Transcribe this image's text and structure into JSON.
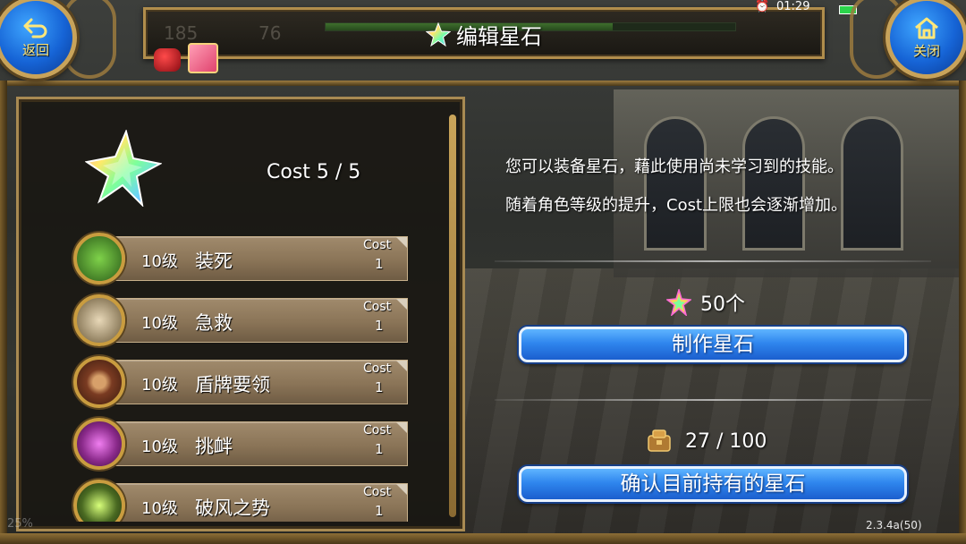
{
  "status_bar": {
    "time": "01:29"
  },
  "hud": {
    "stat_a": "185",
    "stat_b": "76"
  },
  "header": {
    "title": "编辑星石"
  },
  "nav": {
    "back_label": "返回",
    "close_label": "关闭"
  },
  "panel": {
    "cost_text": "Cost 5 / 5",
    "skills": [
      {
        "level": "10级",
        "name": "装死",
        "cost_label": "Cost",
        "cost": "1",
        "icon": "feign-death-icon",
        "color": "#3c7a2a"
      },
      {
        "level": "10级",
        "name": "急救",
        "cost_label": "Cost",
        "cost": "1",
        "icon": "first-aid-icon",
        "color": "#6b5a3a"
      },
      {
        "level": "10级",
        "name": "盾牌要领",
        "cost_label": "Cost",
        "cost": "1",
        "icon": "shield-mastery-icon",
        "color": "#7a3b22"
      },
      {
        "level": "10级",
        "name": "挑衅",
        "cost_label": "Cost",
        "cost": "1",
        "icon": "provoke-icon",
        "color": "#8a2a8a"
      },
      {
        "level": "10级",
        "name": "破风之势",
        "cost_label": "Cost",
        "cost": "1",
        "icon": "wind-breaker-icon",
        "color": "#4a6a22"
      }
    ]
  },
  "info": {
    "line1": "您可以装备星石，藉此使用尚未学习到的技能。",
    "line2": "随着角色等级的提升，Cost上限也会逐渐增加。",
    "stone_count": "50个",
    "craft_button": "制作星石",
    "bag_count": "27 / 100",
    "confirm_button": "确认目前持有的星石"
  },
  "footer": {
    "version": "2.3.4a(50)",
    "percent": "25%"
  },
  "colors": {
    "accent_blue": "#2f86ee",
    "frame_gold": "#b08d4c",
    "skill_bar": "#8a7457"
  }
}
